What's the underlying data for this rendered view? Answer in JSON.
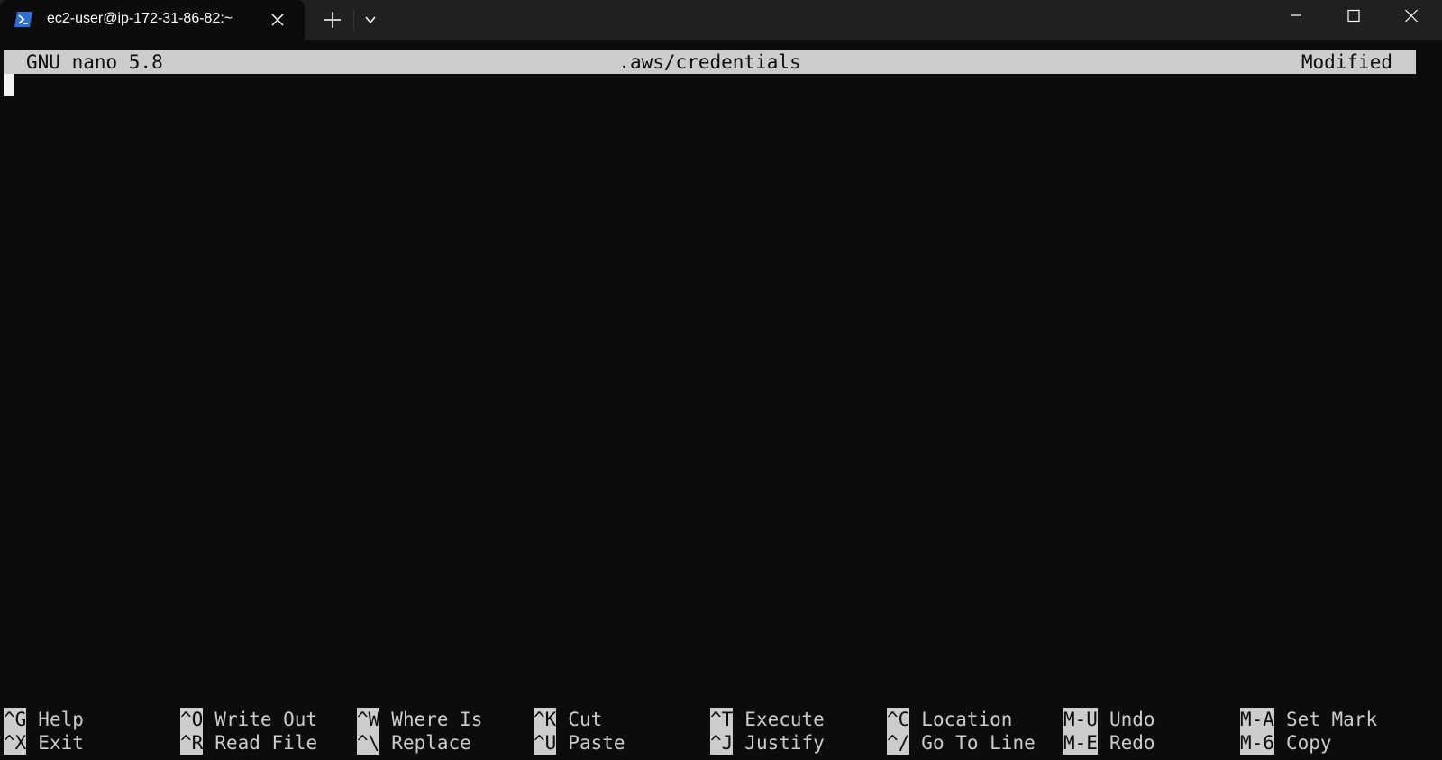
{
  "window": {
    "tab_title": "ec2-user@ip-172-31-86-82:~",
    "tab_icon": "powershell-icon",
    "colors": {
      "background": "#0c0c0c",
      "titlebar": "#202020",
      "foreground": "#cccccc",
      "accent_icon": "#2b6fd8"
    }
  },
  "nano": {
    "version_label": "GNU nano 5.8",
    "filename": ".aws/credentials",
    "status": "Modified",
    "content": ""
  },
  "shortcuts": [
    [
      {
        "key": "^G",
        "label": "Help"
      },
      {
        "key": "^X",
        "label": "Exit"
      }
    ],
    [
      {
        "key": "^O",
        "label": "Write Out"
      },
      {
        "key": "^R",
        "label": "Read File"
      }
    ],
    [
      {
        "key": "^W",
        "label": "Where Is"
      },
      {
        "key": "^\\",
        "label": "Replace"
      }
    ],
    [
      {
        "key": "^K",
        "label": "Cut"
      },
      {
        "key": "^U",
        "label": "Paste"
      }
    ],
    [
      {
        "key": "^T",
        "label": "Execute"
      },
      {
        "key": "^J",
        "label": "Justify"
      }
    ],
    [
      {
        "key": "^C",
        "label": "Location"
      },
      {
        "key": "^/",
        "label": "Go To Line"
      }
    ],
    [
      {
        "key": "M-U",
        "label": "Undo"
      },
      {
        "key": "M-E",
        "label": "Redo"
      }
    ],
    [
      {
        "key": "M-A",
        "label": "Set Mark"
      },
      {
        "key": "M-6",
        "label": "Copy"
      }
    ]
  ]
}
